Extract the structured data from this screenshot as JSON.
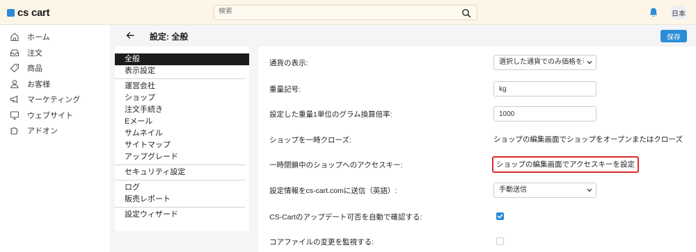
{
  "header": {
    "logo_text": "cs cart",
    "search_placeholder": "検索",
    "language_label": "日本"
  },
  "sidebar": {
    "items": [
      {
        "label": "ホーム",
        "icon": "home-icon"
      },
      {
        "label": "注文",
        "icon": "inbox-icon"
      },
      {
        "label": "商品",
        "icon": "tag-icon"
      },
      {
        "label": "お客様",
        "icon": "user-icon"
      },
      {
        "label": "マーケティング",
        "icon": "megaphone-icon"
      },
      {
        "label": "ウェブサイト",
        "icon": "monitor-icon"
      },
      {
        "label": "アドオン",
        "icon": "puzzle-icon"
      }
    ]
  },
  "page": {
    "title": "設定: 全般",
    "save_label": "保存"
  },
  "sections": {
    "groups": [
      [
        "全般",
        "表示設定"
      ],
      [
        "運営会社",
        "ショップ",
        "注文手続き",
        "Eメール",
        "サムネイル",
        "サイトマップ",
        "アップグレード"
      ],
      [
        "セキュリティ設定"
      ],
      [
        "ログ",
        "販売レポート"
      ],
      [
        "設定ウィザード"
      ]
    ],
    "active": "全般"
  },
  "settings": {
    "currency_display": {
      "label": "通貨の表示:",
      "value": "選択した通貨でのみ価格を表示"
    },
    "weight_symbol": {
      "label": "重量記号:",
      "value": "kg"
    },
    "weight_grams": {
      "label": "設定した重量1単位のグラム換算倍率:",
      "value": "1000"
    },
    "close_shop": {
      "label": "ショップを一時クローズ:",
      "value": "ショップの編集画面でショップをオープンまたはクローズ"
    },
    "access_key": {
      "label": "一時閉鎖中のショップへのアクセスキー:",
      "value": "ショップの編集画面でアクセスキーを設定"
    },
    "send_info": {
      "label": "設定情報をcs-cart.comに送信（英語）:",
      "value": "手動送信"
    },
    "auto_update": {
      "label": "CS-Cartのアップデート可否を自動で確認する:",
      "checked": true
    },
    "monitor_core": {
      "label": "コアファイルの変更を監視する:",
      "checked": false
    }
  },
  "colors": {
    "accent": "#2b8cd8",
    "highlight_border": "#d92a2a",
    "topbar_bg": "#fdf6e8"
  }
}
